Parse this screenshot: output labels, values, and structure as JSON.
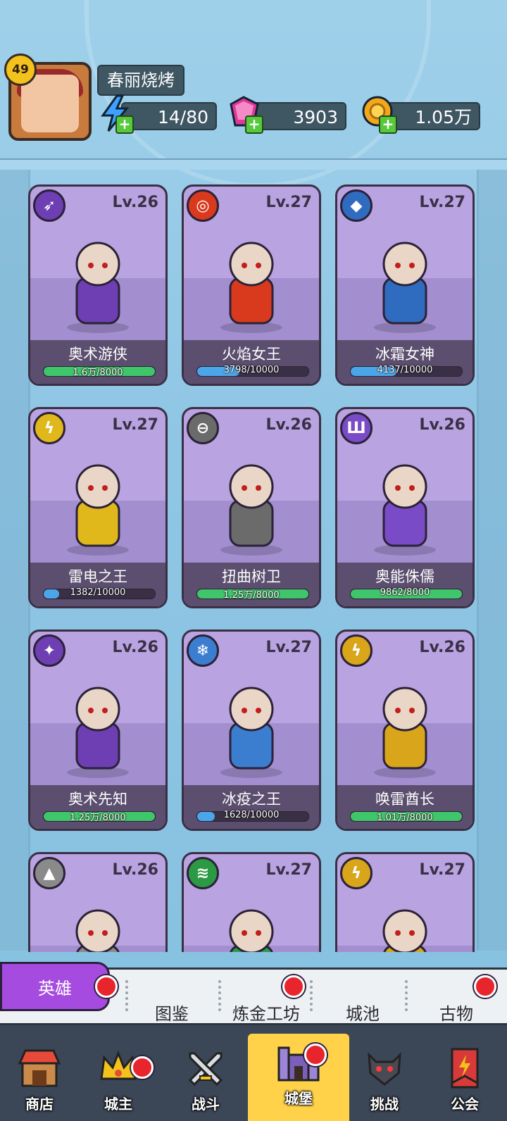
{
  "player": {
    "level": "49",
    "name": "春丽烧烤",
    "energy": "14/80",
    "gems": "3903",
    "gold": "1.05万"
  },
  "heroes": [
    {
      "name": "奥术游侠",
      "level": "Lv.26",
      "progress": "1.6万/8000",
      "fill": 1.0,
      "bar_color": "#3fc56a",
      "element_color": "#6d3fb3",
      "element_glyph": "➶",
      "element_icon": "arrows-icon"
    },
    {
      "name": "火焰女王",
      "level": "Lv.27",
      "progress": "3798/10000",
      "fill": 0.38,
      "bar_color": "#4aa6e8",
      "element_color": "#d93a1e",
      "element_glyph": "◎",
      "element_icon": "fire-ring-icon"
    },
    {
      "name": "冰霜女神",
      "level": "Lv.27",
      "progress": "4137/10000",
      "fill": 0.41,
      "bar_color": "#4aa6e8",
      "element_color": "#2f6cc0",
      "element_glyph": "◆",
      "element_icon": "ice-crystal-icon"
    },
    {
      "name": "雷电之王",
      "level": "Lv.27",
      "progress": "1382/10000",
      "fill": 0.14,
      "bar_color": "#4aa6e8",
      "element_color": "#e0b81b",
      "element_glyph": "ϟ",
      "element_icon": "lightning-icon"
    },
    {
      "name": "扭曲树卫",
      "level": "Lv.26",
      "progress": "1.25万/8000",
      "fill": 1.0,
      "bar_color": "#3fc56a",
      "element_color": "#6b6b6b",
      "element_glyph": "⊖",
      "element_icon": "shield-helmet-icon"
    },
    {
      "name": "奥能侏儒",
      "level": "Lv.26",
      "progress": "9862/8000",
      "fill": 1.0,
      "bar_color": "#3fc56a",
      "element_color": "#7a4bc6",
      "element_glyph": "Ш",
      "element_icon": "claw-icon"
    },
    {
      "name": "奥术先知",
      "level": "Lv.26",
      "progress": "1.25万/8000",
      "fill": 1.0,
      "bar_color": "#3fc56a",
      "element_color": "#6d3fb3",
      "element_glyph": "✦",
      "element_icon": "arcane-bow-icon"
    },
    {
      "name": "冰疫之王",
      "level": "Lv.27",
      "progress": "1628/10000",
      "fill": 0.16,
      "bar_color": "#4aa6e8",
      "element_color": "#3b7ed0",
      "element_glyph": "❄",
      "element_icon": "ice-shard-icon"
    },
    {
      "name": "唤雷酋长",
      "level": "Lv.26",
      "progress": "1.01万/8000",
      "fill": 1.0,
      "bar_color": "#3fc56a",
      "element_color": "#d9a51b",
      "element_glyph": "ϟ",
      "element_icon": "thunder-icon"
    },
    {
      "name": "",
      "level": "Lv.26",
      "progress": "",
      "fill": 0,
      "bar_color": "#3fc56a",
      "element_color": "#8a8a8a",
      "element_glyph": "▲",
      "element_icon": "rock-icon"
    },
    {
      "name": "",
      "level": "Lv.27",
      "progress": "",
      "fill": 0,
      "bar_color": "#3fc56a",
      "element_color": "#2c9a45",
      "element_glyph": "≋",
      "element_icon": "wind-icon"
    },
    {
      "name": "",
      "level": "Lv.27",
      "progress": "",
      "fill": 0,
      "bar_color": "#3fc56a",
      "element_color": "#d9a51b",
      "element_glyph": "ϟ",
      "element_icon": "storm-icon"
    }
  ],
  "subtabs": {
    "heroes": "英雄",
    "codex": "图鉴",
    "alchemy": "炼金工坊",
    "city": "城池",
    "relics": "古物"
  },
  "nav": {
    "shop": "商店",
    "lord": "城主",
    "battle": "战斗",
    "castle": "城堡",
    "challenge": "挑战",
    "guild": "公会"
  }
}
